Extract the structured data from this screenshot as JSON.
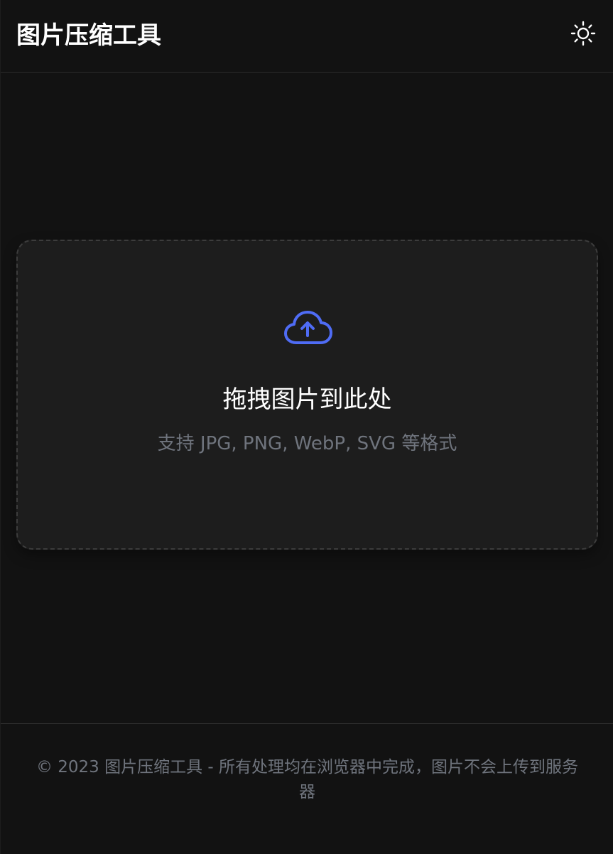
{
  "header": {
    "title": "图片压缩工具",
    "theme_icon": "sun-icon"
  },
  "dropzone": {
    "icon": "cloud-upload-icon",
    "title": "拖拽图片到此处",
    "subtitle": "支持 JPG, PNG, WebP, SVG 等格式"
  },
  "footer": {
    "text": "© 2023 图片压缩工具 - 所有处理均在浏览器中完成，图片不会上传到服务器"
  },
  "colors": {
    "background": "#121212",
    "surface": "#1d1d1d",
    "border": "#2b2b2b",
    "accent": "#4f6cf5",
    "muted_text": "#6f747d",
    "text": "#ffffff"
  }
}
